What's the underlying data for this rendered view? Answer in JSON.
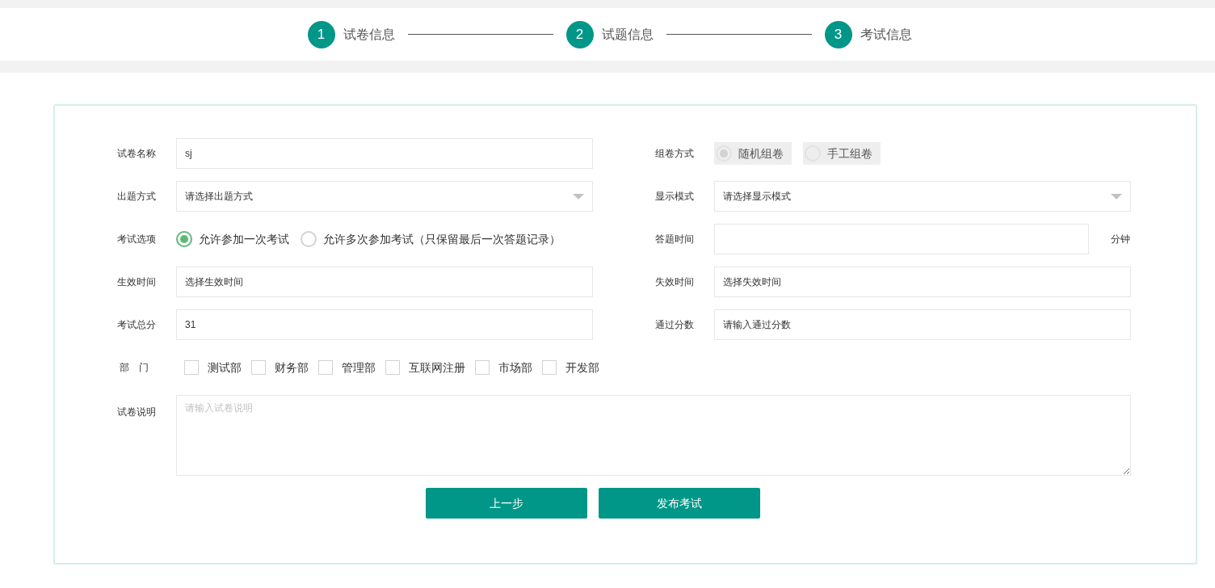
{
  "steps": [
    {
      "number": "1",
      "label": "试卷信息",
      "completed": true
    },
    {
      "number": "2",
      "label": "试题信息",
      "completed": true
    },
    {
      "number": "3",
      "label": "考试信息",
      "completed": true
    }
  ],
  "rows": [
    [
      {
        "kind": "text",
        "label": "试卷名称",
        "value": "sj"
      },
      {
        "kind": "radio",
        "label": "组卷方式",
        "disabled": true,
        "options": [
          {
            "label": "随机组卷",
            "selected": true
          },
          {
            "label": "手工组卷",
            "selected": false
          }
        ]
      }
    ],
    [
      {
        "kind": "select",
        "label": "出题方式",
        "placeholder": "请选择出题方式"
      },
      {
        "kind": "select",
        "label": "显示模式",
        "placeholder": "请选择显示模式"
      }
    ],
    [
      {
        "kind": "radio",
        "label": "考试选项",
        "disabled": false,
        "options": [
          {
            "label": "允许参加一次考试",
            "selected": true
          },
          {
            "label": "允许多次参加考试（只保留最后一次答题记录）",
            "selected": false
          }
        ]
      },
      {
        "kind": "unit",
        "label": "答题时间",
        "unit": "分钟"
      }
    ],
    [
      {
        "kind": "text",
        "label": "生效时间",
        "value": "选择生效时间"
      },
      {
        "kind": "text",
        "label": "失效时间",
        "value": "选择失效时间"
      }
    ],
    [
      {
        "kind": "text",
        "label": "考试总分",
        "value": "31"
      },
      {
        "kind": "text",
        "label": "通过分数",
        "value": "请输入通过分数"
      }
    ],
    [
      {
        "kind": "checkboxes",
        "label": "部　门",
        "options": [
          {
            "label": "测试部",
            "checked": false
          },
          {
            "label": "财务部",
            "checked": false
          },
          {
            "label": "管理部",
            "checked": false
          },
          {
            "label": "互联网注册",
            "checked": false
          },
          {
            "label": "市场部",
            "checked": false
          },
          {
            "label": "开发部",
            "checked": false
          }
        ]
      }
    ]
  ],
  "description": {
    "label": "试卷说明",
    "placeholder": "请输入试卷说明"
  },
  "buttons": [
    "上一步",
    "发布考试"
  ]
}
